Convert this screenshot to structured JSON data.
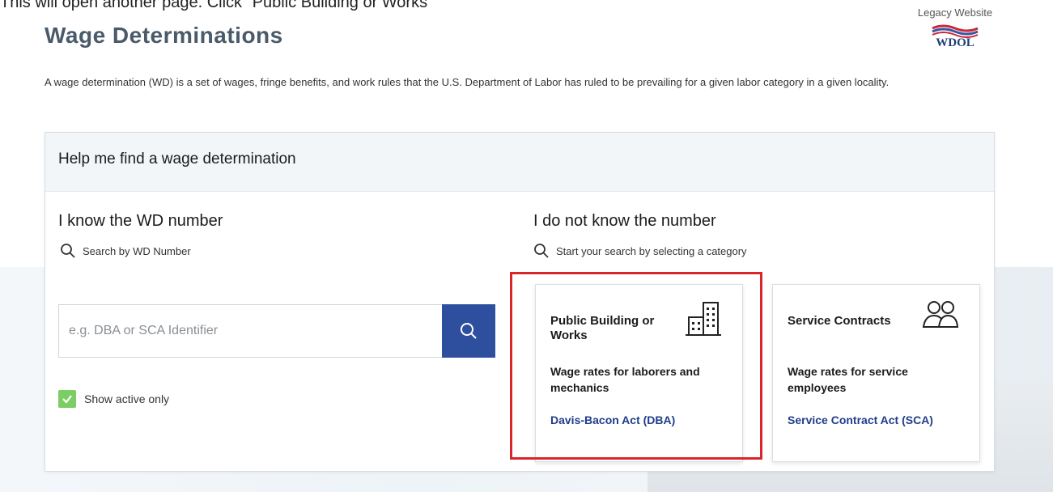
{
  "instruction": "This will open another page. Click \"Public Building or Works\"",
  "page_title": "Wage Determinations",
  "legacy": {
    "label": "Legacy Website",
    "logo_text": "WDOL"
  },
  "intro": "A wage determination (WD) is a set of wages, fringe benefits, and work rules that the U.S. Department of Labor has ruled to be prevailing for a given labor category in a given locality.",
  "panel": {
    "title": "Help me find a wage determination",
    "left": {
      "heading": "I know the WD number",
      "sub": "Search by WD Number",
      "search_placeholder": "e.g. DBA or SCA Identifier",
      "search_value": "",
      "checkbox_label": "Show active only",
      "checkbox_checked": true
    },
    "right": {
      "heading": "I do not know the number",
      "sub": "Start your search by selecting a category",
      "cards": [
        {
          "title": "Public Building or Works",
          "icon": "building-icon",
          "description": "Wage rates for laborers and mechanics",
          "link": "Davis-Bacon Act (DBA)"
        },
        {
          "title": "Service Contracts",
          "icon": "people-icon",
          "description": "Wage rates for service employees",
          "link": "Service Contract Act (SCA)"
        }
      ]
    }
  },
  "colors": {
    "title": "#4a5a6a",
    "search_button": "#2e4f9e",
    "checkbox": "#7ccd64",
    "link": "#1f3d8a",
    "highlight": "#d9262c"
  }
}
